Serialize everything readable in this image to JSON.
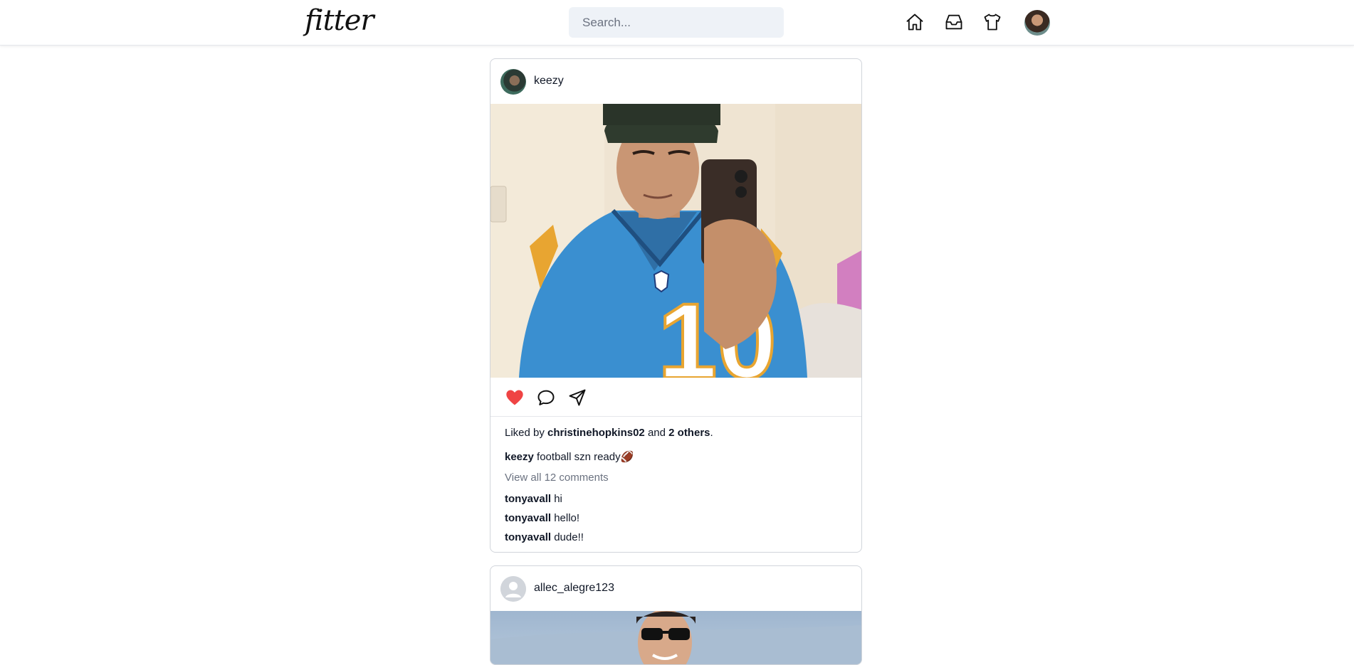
{
  "header": {
    "logo": "fitter",
    "search_placeholder": "Search...",
    "nav": [
      "home-icon",
      "inbox-icon",
      "shirt-icon",
      "profile-avatar"
    ]
  },
  "posts": [
    {
      "username": "keezy",
      "liked_prefix": "Liked by",
      "liked_user": "christinehopkins02",
      "liked_and": "and",
      "liked_others": "2 others",
      "liked_end": ".",
      "caption_user": "keezy",
      "caption": "football szn ready🏈",
      "view_all": "View all 12 comments",
      "comments": [
        {
          "user": "tonyavall",
          "text": "hi"
        },
        {
          "user": "tonyavall",
          "text": "hello!"
        },
        {
          "user": "tonyavall",
          "text": "dude!!"
        }
      ],
      "jersey_number": "10",
      "liked": true
    },
    {
      "username": "allec_alegre123"
    }
  ],
  "colors": {
    "like": "#ef4444",
    "search_bg": "#eef2f7",
    "border": "#d1d5db"
  }
}
